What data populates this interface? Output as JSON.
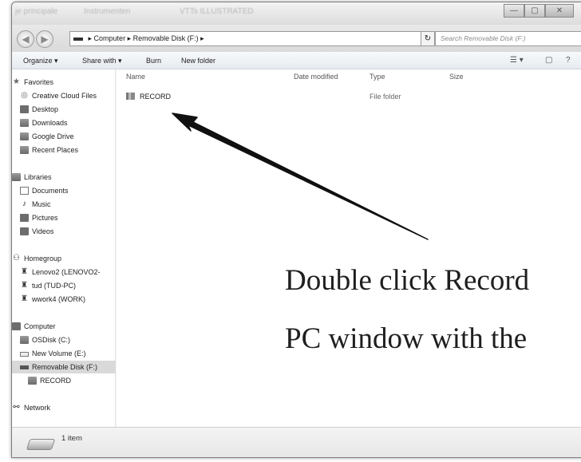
{
  "window": {
    "tabs": [
      "je principale",
      "Instrumenten",
      "VTTs ILLUSTRATED"
    ],
    "controls": {
      "minimize": "—",
      "maximize": "▢",
      "close": "✕"
    }
  },
  "address": {
    "segments": [
      "Computer",
      "Removable Disk (F:)"
    ],
    "search_placeholder": "Search Removable Disk (F:)"
  },
  "toolbar": {
    "organize": "Organize ▾",
    "share_with": "Share with ▾",
    "burn": "Burn",
    "new_folder": "New folder"
  },
  "navigation": {
    "favorites": {
      "header": "Favorites",
      "items": [
        "Creative Cloud Files",
        "Desktop",
        "Downloads",
        "Google Drive",
        "Recent Places"
      ]
    },
    "libraries": {
      "header": "Libraries",
      "items": [
        "Documents",
        "Music",
        "Pictures",
        "Videos"
      ]
    },
    "homegroup": {
      "header": "Homegroup",
      "items": [
        "Lenovo2 (LENOVO2-",
        "tud (TUD-PC)",
        "wwork4 (WORK)"
      ]
    },
    "computer": {
      "header": "Computer",
      "items": [
        "OSDisk (C:)",
        "New Volume (E:)",
        "Removable Disk (F:)",
        "RECORD"
      ],
      "selected": "Removable Disk (F:)"
    },
    "network": {
      "header": "Network"
    }
  },
  "columns": [
    "Name",
    "Date modified",
    "Type",
    "Size"
  ],
  "files": [
    {
      "name": "RECORD",
      "date_modified": "",
      "type": "File folder",
      "size": ""
    }
  ],
  "status": {
    "count": "1 item"
  },
  "annotation": {
    "line1": "Double click Record",
    "line2": "PC window with the"
  }
}
